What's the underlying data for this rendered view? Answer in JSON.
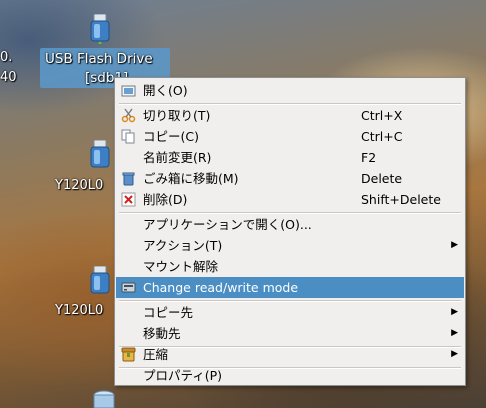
{
  "desktop": {
    "left_edge_text": [
      "0.",
      "40"
    ],
    "icons": [
      {
        "label_line1": "USB Flash Drive",
        "label_line2": "[sdb1]"
      },
      {
        "label": "Y120L0"
      },
      {
        "label": "Y120L0"
      }
    ]
  },
  "context_menu": {
    "items": [
      {
        "label": "開く(O)",
        "accel_key": "O",
        "accelerator": "",
        "icon": "folder-open-icon"
      },
      {
        "label": "切り取り(T)",
        "accelerator": "Ctrl+X",
        "icon": "cut-icon"
      },
      {
        "label": "コピー(C)",
        "accelerator": "Ctrl+C",
        "icon": "copy-icon"
      },
      {
        "label": "名前変更(R)",
        "accelerator": "F2",
        "icon": ""
      },
      {
        "label": "ごみ箱に移動(M)",
        "accelerator": "Delete",
        "icon": "trash-icon"
      },
      {
        "label": "削除(D)",
        "accelerator": "Shift+Delete",
        "icon": "delete-icon"
      },
      {
        "label": "アプリケーションで開く(O)...",
        "accelerator": "",
        "icon": ""
      },
      {
        "label": "アクション(T)",
        "accelerator": "",
        "icon": "",
        "submenu": true
      },
      {
        "label": "マウント解除",
        "accelerator": "",
        "icon": ""
      },
      {
        "label": "Change read/write mode",
        "accelerator": "",
        "icon": "drive-icon",
        "highlighted": true
      },
      {
        "label": "コピー先",
        "accelerator": "",
        "icon": "",
        "submenu": true
      },
      {
        "label": "移動先",
        "accelerator": "",
        "icon": "",
        "submenu": true
      },
      {
        "label": "圧縮",
        "accelerator": "",
        "icon": "archive-icon",
        "submenu": true
      },
      {
        "label": "プロパティ(P)",
        "accelerator": "",
        "icon": ""
      }
    ]
  },
  "colors": {
    "highlight": "#4a8ec4",
    "menu_bg": "#f0efee",
    "selection": "#5b97c7"
  }
}
